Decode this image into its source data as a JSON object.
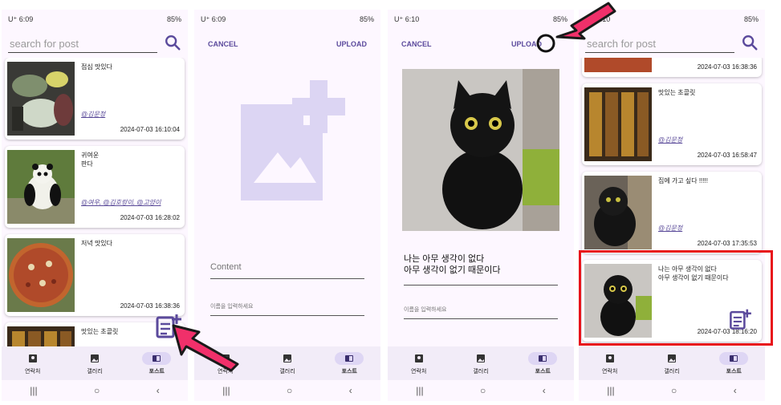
{
  "status": {
    "carrier": "U⁺",
    "time_1": "6:09",
    "time_2": "6:09",
    "time_3": "6:10",
    "time_4": "6:10",
    "battery": "85%"
  },
  "search": {
    "placeholder": "search for post"
  },
  "posts": [
    {
      "content": "점심 맛있다",
      "tags": "@김문정",
      "time": "2024-07-03 16:10:04"
    },
    {
      "content": "귀여운\n판다",
      "tags": "@여우, @김호랑이, @고양이",
      "time": "2024-07-03 16:28:02"
    },
    {
      "content": "저녁 맛있다",
      "tags": "",
      "time": "2024-07-03 16:38:36"
    },
    {
      "content": "맛있는 초콜릿",
      "tags": "",
      "time": ""
    }
  ],
  "posts_scrolled": [
    {
      "content": "",
      "tags": "",
      "time": "2024-07-03 16:38:36"
    },
    {
      "content": "맛있는 초콜릿",
      "tags": "@김문정",
      "time": "2024-07-03 16:58:47"
    },
    {
      "content": "집에 가고 싶다 !!!!!",
      "tags": "@김문정",
      "time": "2024-07-03 17:35:53"
    },
    {
      "content": "나는 아무 생각이 없다\n아무 생각이 없기 때문이다",
      "tags": "",
      "time": "2024-07-03 18:16:20"
    }
  ],
  "nav": {
    "contacts": "연락처",
    "gallery": "갤러리",
    "post": "포스트"
  },
  "editor": {
    "cancel": "CANCEL",
    "upload": "UPLOAD",
    "content_placeholder": "Content",
    "name_placeholder": "이름을 입력하세요",
    "content_value": "나는 아무 생각이 없다\n아무 생각이 없기 때문이다"
  },
  "colors": {
    "accent": "#5b4a9c",
    "nav_bg": "#f2ecf8",
    "placeholder_icon": "#dcd5f3",
    "highlight": "#e8141b",
    "pointer": "#f0306a"
  }
}
